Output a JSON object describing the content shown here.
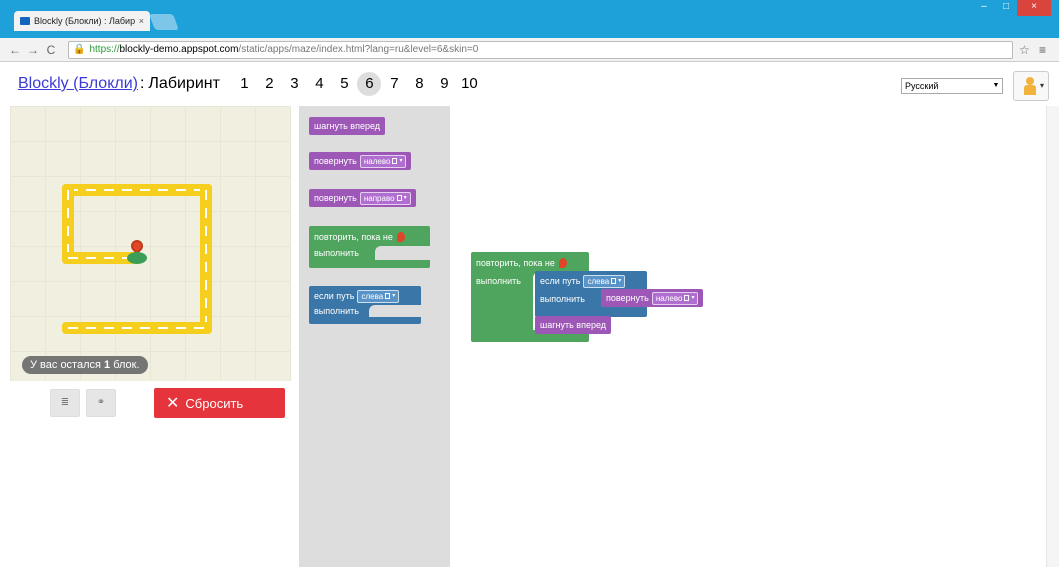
{
  "browser": {
    "tab_title": "Blockly (Блокли) : Лабир",
    "tab_close": "×",
    "url_https": "https://",
    "url_host": "blockly-demo.appspot.com",
    "url_rest": "/static/apps/maze/index.html?lang=ru&level=6&skin=0",
    "back": "←",
    "forward": "→",
    "reload": "C",
    "lock": "🔒",
    "star": "☆",
    "menu": "≡",
    "minimize": "–",
    "maximize": "□",
    "close": "×"
  },
  "header": {
    "title_link": "Blockly (Блокли)",
    "title_sep": ":",
    "title_rest": "Лабиринт",
    "levels": [
      "1",
      "2",
      "3",
      "4",
      "5",
      "6",
      "7",
      "8",
      "9",
      "10"
    ],
    "current_level": "6",
    "language": "Русский",
    "language_arrow": "▼",
    "pegman_caret": "▾"
  },
  "maze": {
    "blocks_left_prefix": "У вас остался ",
    "blocks_left_count": "1",
    "blocks_left_suffix": " блок."
  },
  "controls": {
    "code_icon": "≣",
    "link_icon": "⚭",
    "reset_x": "✕",
    "reset_label": "Сбросить"
  },
  "toolbox": {
    "move_forward": "шагнуть вперед",
    "turn": "повернуть",
    "left": "налево",
    "right": "направо",
    "repeat_until": "повторить, пока не",
    "do": "выполнить",
    "if_path": "если путь",
    "ahead_left": "слева",
    "dropdown_arrow": "▾"
  },
  "workspace": {
    "repeat_until": "повторить, пока не",
    "do": "выполнить",
    "if_path": "если путь",
    "path_dir": "слева",
    "inner_do": "выполнить",
    "turn": "повернуть",
    "turn_dir": "налево",
    "move_forward": "шагнуть вперед",
    "dropdown_arrow": "▾"
  },
  "colors": {
    "chrome": "#1ea0d8",
    "movement_block": "#9d58b7",
    "loop_block": "#4fa55e",
    "logic_block": "#3a76a8",
    "reset_button": "#e5343b",
    "road": "#f6cf1e"
  }
}
